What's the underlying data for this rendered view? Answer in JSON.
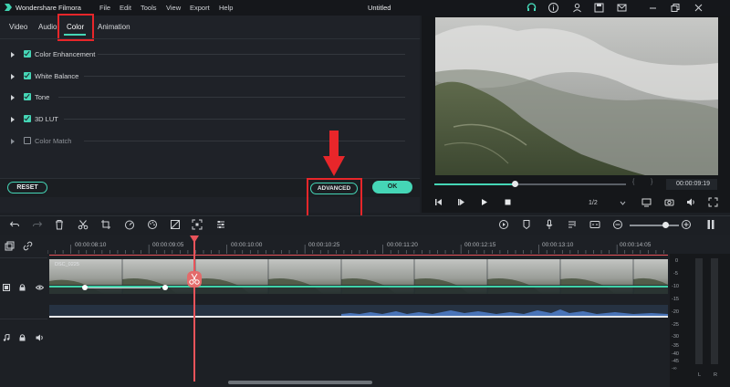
{
  "titlebar": {
    "app_name": "Wondershare Filmora",
    "menu": [
      "File",
      "Edit",
      "Tools",
      "View",
      "Export",
      "Help"
    ],
    "document_title": "Untitled"
  },
  "tabs": [
    {
      "label": "Video"
    },
    {
      "label": "Audio"
    },
    {
      "label": "Color",
      "active": true
    },
    {
      "label": "Animation"
    }
  ],
  "color_settings": [
    {
      "label": "Color Enhancement",
      "checked": true
    },
    {
      "label": "White Balance",
      "checked": true
    },
    {
      "label": "Tone",
      "checked": true
    },
    {
      "label": "3D LUT",
      "checked": true
    },
    {
      "label": "Color Match",
      "checked": false
    }
  ],
  "buttons": {
    "reset": "RESET",
    "advanced": "ADVANCED",
    "ok": "OK"
  },
  "preview": {
    "timecode": "00:00:09:19",
    "quality": "1/2",
    "progress_fraction": 0.42
  },
  "timeline": {
    "ruler_ticks": [
      "00:00:08:10",
      "00:00:09:05",
      "00:00:10:00",
      "00:00:10:25",
      "00:00:11:20",
      "00:00:12:15",
      "00:00:13:10",
      "00:00:14:05"
    ],
    "clip_name": "DSC_0225"
  },
  "vu_meter": {
    "scale": [
      "0",
      "-5",
      "-10",
      "-15",
      "-20",
      "-25",
      "-30",
      "-35",
      "-40",
      "-45",
      "-∞"
    ],
    "channels": [
      "L",
      "R"
    ]
  },
  "colors": {
    "accent": "#45d6b6",
    "highlight": "#e8262a",
    "playhead": "#e8535a"
  }
}
